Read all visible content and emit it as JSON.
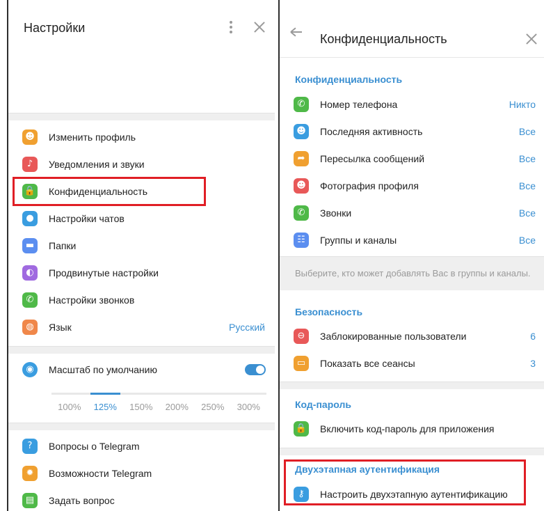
{
  "left": {
    "title": "Настройки",
    "menu": [
      {
        "label": "Изменить профиль",
        "icon": "profile-icon",
        "color": "#f0a030",
        "glyph": "☻"
      },
      {
        "label": "Уведомления и звуки",
        "icon": "bell-icon",
        "color": "#e85858",
        "glyph": "♪"
      },
      {
        "label": "Конфиденциальность",
        "icon": "lock-icon",
        "color": "#4fb948",
        "glyph": "🔒"
      },
      {
        "label": "Настройки чатов",
        "icon": "chat-icon",
        "color": "#3a9de0",
        "glyph": "●"
      },
      {
        "label": "Папки",
        "icon": "folder-icon",
        "color": "#5b8ef0",
        "glyph": "▬"
      },
      {
        "label": "Продвинутые настройки",
        "icon": "advanced-icon",
        "color": "#a06ae0",
        "glyph": "◐"
      },
      {
        "label": "Настройки звонков",
        "icon": "phone-icon",
        "color": "#4fb948",
        "glyph": "✆"
      },
      {
        "label": "Язык",
        "icon": "globe-icon",
        "color": "#f0874a",
        "glyph": "◍",
        "value": "Русский"
      }
    ],
    "scale": {
      "label": "Масштаб по умолчанию",
      "icon": "eye-icon",
      "color": "#3a9de0",
      "enabled": true,
      "options": [
        "100%",
        "125%",
        "150%",
        "200%",
        "250%",
        "300%"
      ],
      "selected": "125%"
    },
    "help": [
      {
        "label": "Вопросы о Telegram",
        "icon": "question-icon",
        "color": "#3a9de0",
        "glyph": "?"
      },
      {
        "label": "Возможности Telegram",
        "icon": "bulb-icon",
        "color": "#f0a030",
        "glyph": "✹"
      },
      {
        "label": "Задать вопрос",
        "icon": "chat-bubble-icon",
        "color": "#4fb948",
        "glyph": "▤"
      }
    ]
  },
  "right": {
    "title": "Конфиденциальность",
    "privacy_section": "Конфиденциальность",
    "privacy": [
      {
        "label": "Номер телефона",
        "value": "Никто",
        "icon": "phone-icon",
        "color": "#4fb948",
        "glyph": "✆"
      },
      {
        "label": "Последняя активность",
        "value": "Все",
        "icon": "user-clock-icon",
        "color": "#3a9de0",
        "glyph": "☻"
      },
      {
        "label": "Пересылка сообщений",
        "value": "Все",
        "icon": "forward-icon",
        "color": "#f0a030",
        "glyph": "➦"
      },
      {
        "label": "Фотография профиля",
        "value": "Все",
        "icon": "profile-photo-icon",
        "color": "#e85858",
        "glyph": "☻"
      },
      {
        "label": "Звонки",
        "value": "Все",
        "icon": "calls-icon",
        "color": "#4fb948",
        "glyph": "✆"
      },
      {
        "label": "Группы и каналы",
        "value": "Все",
        "icon": "groups-icon",
        "color": "#5b8ef0",
        "glyph": "☷"
      }
    ],
    "privacy_hint": "Выберите, кто может добавлять Вас в группы и каналы.",
    "security_section": "Безопасность",
    "security": [
      {
        "label": "Заблокированные пользователи",
        "value": "6",
        "icon": "blocked-icon",
        "color": "#e85858",
        "glyph": "⊖"
      },
      {
        "label": "Показать все сеансы",
        "value": "3",
        "icon": "laptop-icon",
        "color": "#f0a030",
        "glyph": "▭"
      }
    ],
    "passcode_section": "Код-пароль",
    "passcode": {
      "label": "Включить код-пароль для приложения",
      "icon": "lock-icon",
      "color": "#4fb948",
      "glyph": "🔒"
    },
    "twofa_section": "Двухэтапная аутентификация",
    "twofa": {
      "label": "Настроить двухэтапную аутентификацию",
      "icon": "key-icon",
      "color": "#3a9de0",
      "glyph": "⚷"
    }
  }
}
